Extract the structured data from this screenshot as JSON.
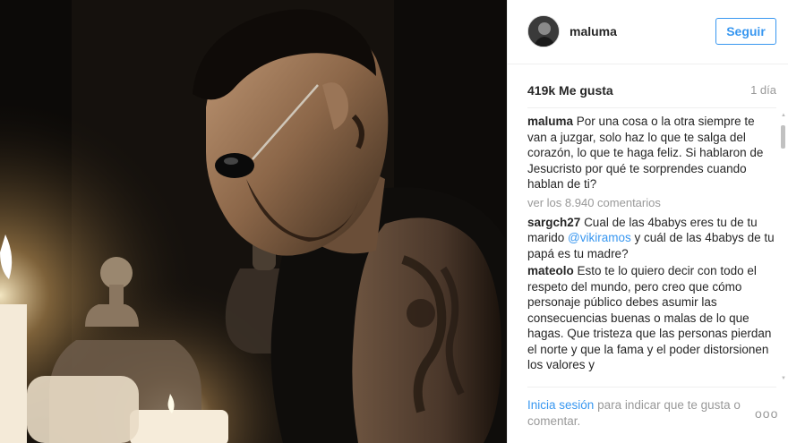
{
  "post": {
    "username": "maluma",
    "follow_label": "Seguir",
    "likes": "419k Me gusta",
    "time_ago": "1 día",
    "caption": {
      "author": "maluma",
      "text": "Por una cosa o la otra siempre te van a juzgar, solo haz lo que te salga del corazón, lo que te haga feliz. Si hablaron de Jesucristo por qué te sorprendes cuando hablan de ti?"
    },
    "view_all_comments": "ver los 8.940 comentarios",
    "comments": [
      {
        "author": "sargch27",
        "text_before": "Cual de las 4babys eres tu de tu marido",
        "mention": "@vikiramos",
        "text_after": "y cuál de las 4babys de tu papá es tu madre?"
      },
      {
        "author": "mateolo",
        "text": "Esto te lo quiero decir con todo el respeto del mundo, pero creo que cómo personaje público debes asumir las consecuencias buenas o malas de lo que hagas. Que tristeza que las personas pierdan el norte y que la fama y el poder distorsionen los valores y"
      }
    ],
    "footer": {
      "login_link": "Inicia sesión",
      "login_text": "para indicar que te gusta o comentar.",
      "more_label": "ooo"
    }
  },
  "icons": {
    "avatar": "profile-avatar",
    "more": "more-options-icon"
  },
  "colors": {
    "accent": "#3897f0",
    "muted": "#999999",
    "text": "#262626",
    "border": "#efefef"
  }
}
